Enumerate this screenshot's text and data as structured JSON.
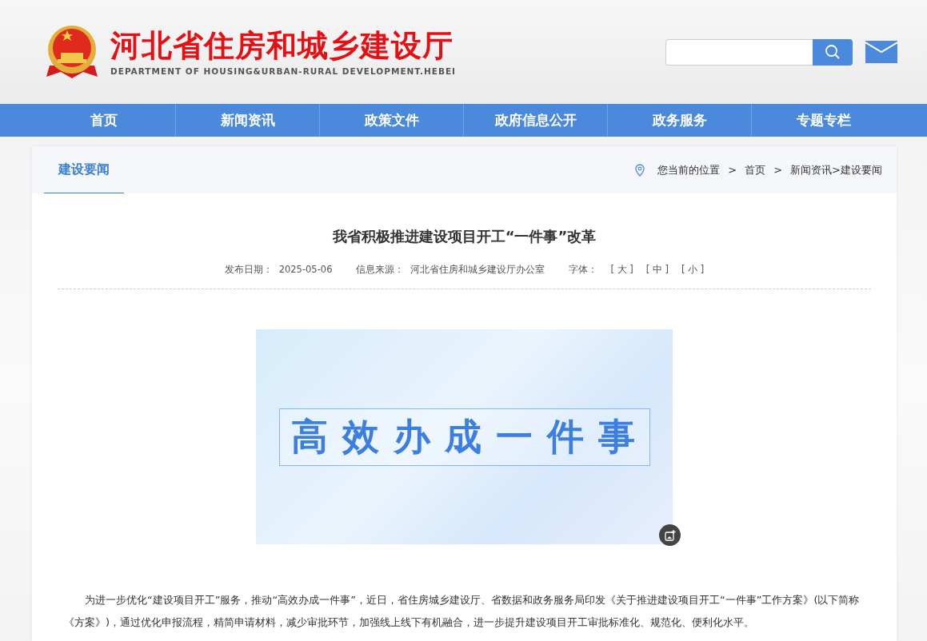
{
  "header": {
    "site_title": "河北省住房和城乡建设厅",
    "site_subtitle": "DEPARTMENT OF HOUSING&URBAN-RURAL DEVELOPMENT.HEBEI"
  },
  "nav": [
    "首页",
    "新闻资讯",
    "政策文件",
    "政府信息公开",
    "政务服务",
    "专题专栏"
  ],
  "section_tab": {
    "label": "建设要闻",
    "selected": true
  },
  "breadcrumb": {
    "prefix": "您当前的位置",
    "items": [
      {
        "text": "首页",
        "sep": ">"
      },
      {
        "text": "新闻资讯>建设要闻",
        "sep": ">"
      }
    ]
  },
  "article": {
    "title": "我省积极推进建设项目开工“一件事”改革",
    "date_label": "发布日期：",
    "date": "2025-05-06",
    "source_label": "信息来源：",
    "source": "河北省住房和城乡建设厅办公室",
    "font_label": "字体：",
    "font_sizes": [
      "[ 大 ]",
      "[ 中 ]",
      "[ 小 ]"
    ],
    "banner_text": "高效办成一件事",
    "paragraph": "为进一步优化“建设项目开工”服务，推动“高效办成一件事”，近日，省住房城乡建设厅、省数据和政务服务局印发《关于推进建设项目开工“一件事”工作方案》(以下简称《方案》)，通过优化申报流程，精简申请材料，减少审批环节，加强线上线下有机融合，进一步提升建设项目开工审批标准化、规范化、便利化水平。"
  }
}
